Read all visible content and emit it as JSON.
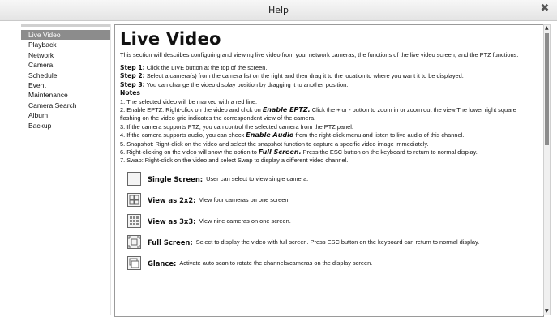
{
  "window": {
    "title": "Help",
    "close_icon": "close-icon"
  },
  "sidebar": {
    "items": [
      {
        "label": "Live Video",
        "active": true
      },
      {
        "label": "Playback"
      },
      {
        "label": "Network"
      },
      {
        "label": "Camera"
      },
      {
        "label": "Schedule"
      },
      {
        "label": "Event"
      },
      {
        "label": "Maintenance"
      },
      {
        "label": "Camera Search"
      },
      {
        "label": "Album"
      },
      {
        "label": "Backup"
      }
    ]
  },
  "content": {
    "title": "Live Video",
    "intro": "This section will describes configuring and viewing live video from your network cameras, the functions of the live video screen, and the PTZ functions.",
    "steps": [
      {
        "label": "Step 1:",
        "text": "Click the LIVE button at the top of the screen."
      },
      {
        "label": "Step 2:",
        "text": "Select a camera(s) from the camera list on the right and then drag it to the location to where you want it to be displayed."
      },
      {
        "label": "Step 3:",
        "text": "You can change the video display position by dragging it to another position."
      }
    ],
    "notes_heading": "Notes",
    "notes": [
      {
        "pre": "1. The selected video will be marked with a red line.",
        "em": "",
        "post": ""
      },
      {
        "pre": "2. Enable EPTZ: Right-click on the video and click on ",
        "em": "Enable EPTZ.",
        "post": " Click the + or - button to zoom in or zoom out the view.The lower right square flashing on the video grid indicates the correspondent view of the camera."
      },
      {
        "pre": "3. If the camera supports PTZ, you can control the selected camera from the PTZ panel.",
        "em": "",
        "post": ""
      },
      {
        "pre": "4. If the camera supports audio, you can check ",
        "em": "Enable Audio",
        "post": " from the right-click menu and listen to live audio of this channel."
      },
      {
        "pre": "5. Snapshot: Right-click on the video and select the snapshot function to capture a specific video image immediately.",
        "em": "",
        "post": ""
      },
      {
        "pre": "6. Right-clicking on the video will show the option to ",
        "em": "Full Screen.",
        "post": " Press the ESC button on the keyboard to return to normal display."
      },
      {
        "pre": "7. Swap: Right-click on the video and select Swap to display a different video channel.",
        "em": "",
        "post": ""
      }
    ],
    "features": [
      {
        "icon": "single-screen-icon",
        "name": "Single Screen:",
        "desc": "User can select to view single camera."
      },
      {
        "icon": "grid-2x2-icon",
        "name": "View as 2x2:",
        "desc": "View four cameras on one screen."
      },
      {
        "icon": "grid-3x3-icon",
        "name": "View as 3x3:",
        "desc": "View nine cameras on one screen."
      },
      {
        "icon": "full-screen-icon",
        "name": "Full Screen:",
        "desc": "Select to display the video with full screen. Press ESC button on the keyboard can return to normal display."
      },
      {
        "icon": "glance-icon",
        "name": "Glance:",
        "desc": "Activate auto scan to rotate the channels/cameras on the display screen."
      }
    ]
  }
}
